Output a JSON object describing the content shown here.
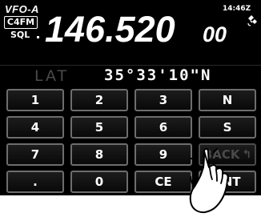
{
  "status": {
    "vfo": "VFO-A",
    "mode": "C4FM",
    "sql": "SQL",
    "time": "14:46Z",
    "frequency_main": "146.520",
    "frequency_sub": "00"
  },
  "input": {
    "label": "LAT",
    "value": "35°33'10\"N"
  },
  "keypad": {
    "rows": [
      [
        "1",
        "2",
        "3",
        "N"
      ],
      [
        "4",
        "5",
        "6",
        "S"
      ],
      [
        "7",
        "8",
        "9",
        "BACK"
      ],
      [
        ".",
        "0",
        "CE",
        "ENT"
      ]
    ]
  },
  "icons": {
    "satellite": "satellite-icon",
    "hand": "pointing-hand-icon",
    "back": "back-arrow-icon"
  },
  "colors": {
    "screen": "#000000",
    "text": "#ffffff",
    "disabled": "#4a4a4a",
    "key_border": "#6d6d6d"
  }
}
